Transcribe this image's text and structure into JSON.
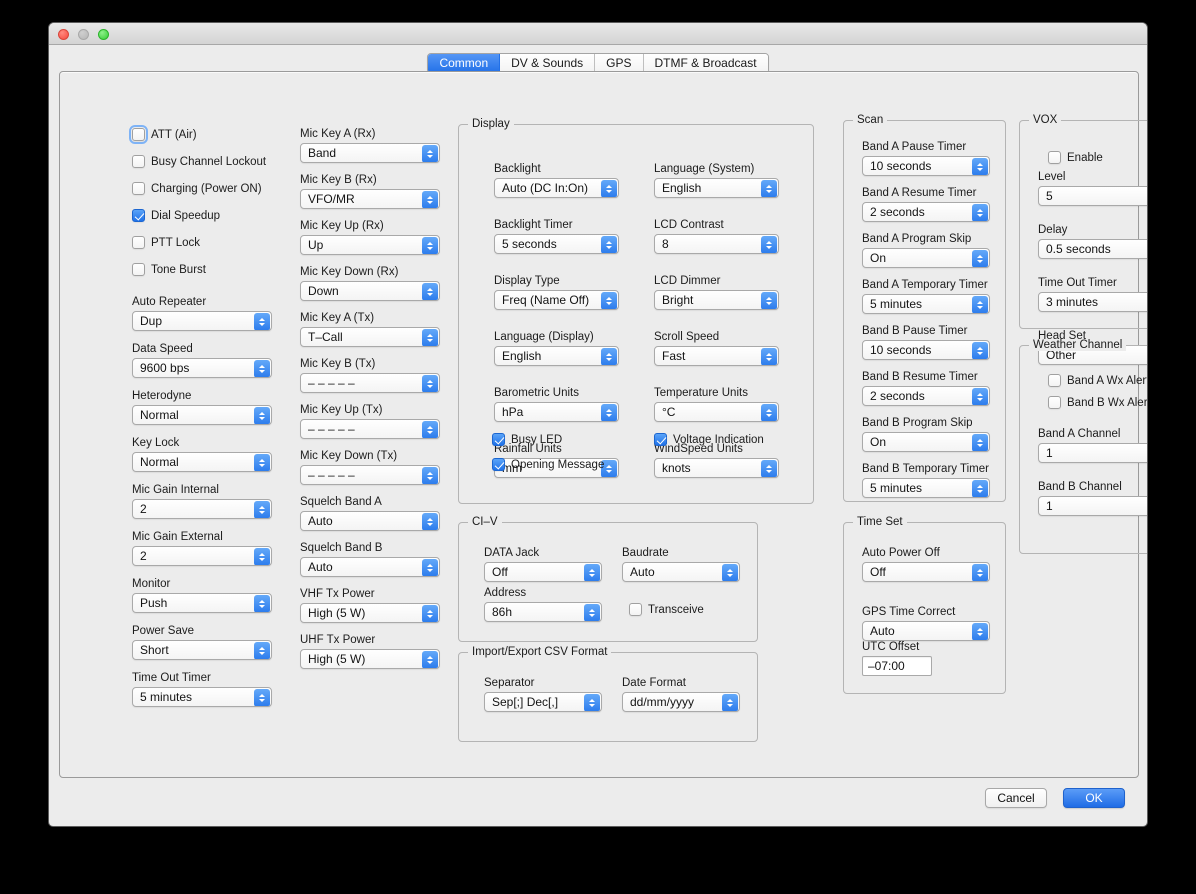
{
  "window": {
    "traffic_lights": [
      "close",
      "minimize",
      "maximize"
    ]
  },
  "tabs": [
    {
      "label": "Common",
      "active": true
    },
    {
      "label": "DV & Sounds",
      "active": false
    },
    {
      "label": "GPS",
      "active": false
    },
    {
      "label": "DTMF & Broadcast",
      "active": false
    }
  ],
  "colors": {
    "accent": "#2170e8",
    "window_bg": "#ececec",
    "border": "#b4b4b4"
  },
  "column1": {
    "checkboxes": [
      {
        "label": "ATT (Air)",
        "checked": false,
        "focused": true
      },
      {
        "label": "Busy Channel Lockout",
        "checked": false,
        "focused": false
      },
      {
        "label": "Charging (Power ON)",
        "checked": false,
        "focused": false
      },
      {
        "label": "Dial Speedup",
        "checked": true,
        "focused": false
      },
      {
        "label": "PTT Lock",
        "checked": false,
        "focused": false
      },
      {
        "label": "Tone Burst",
        "checked": false,
        "focused": false
      }
    ],
    "fields": [
      {
        "label": "Auto Repeater",
        "value": "Dup"
      },
      {
        "label": "Data Speed",
        "value": "9600 bps"
      },
      {
        "label": "Heterodyne",
        "value": "Normal"
      },
      {
        "label": "Key Lock",
        "value": "Normal"
      },
      {
        "label": "Mic Gain Internal",
        "value": "2"
      },
      {
        "label": "Mic Gain External",
        "value": "2"
      },
      {
        "label": "Monitor",
        "value": "Push"
      },
      {
        "label": "Power Save",
        "value": "Short"
      },
      {
        "label": "Time Out Timer",
        "value": "5 minutes"
      }
    ]
  },
  "column2": {
    "fields": [
      {
        "label": "Mic Key A (Rx)",
        "value": "Band"
      },
      {
        "label": "Mic Key B (Rx)",
        "value": "VFO/MR"
      },
      {
        "label": "Mic Key Up (Rx)",
        "value": "Up"
      },
      {
        "label": "Mic Key Down (Rx)",
        "value": "Down"
      },
      {
        "label": "Mic Key A (Tx)",
        "value": "T–Call"
      },
      {
        "label": "Mic Key B (Tx)",
        "value": "– – – – –"
      },
      {
        "label": "Mic Key Up (Tx)",
        "value": "– – – – –"
      },
      {
        "label": "Mic Key Down (Tx)",
        "value": "– – – – –"
      },
      {
        "label": "Squelch Band A",
        "value": "Auto"
      },
      {
        "label": "Squelch Band B",
        "value": "Auto"
      },
      {
        "label": "VHF Tx Power",
        "value": "High (5 W)"
      },
      {
        "label": "UHF Tx Power",
        "value": "High (5 W)"
      }
    ]
  },
  "display_group": {
    "title": "Display",
    "left_fields": [
      {
        "label": "Backlight",
        "value": "Auto (DC In:On)"
      },
      {
        "label": "Backlight Timer",
        "value": "5 seconds"
      },
      {
        "label": "Display Type",
        "value": "Freq (Name Off)"
      },
      {
        "label": "Language (Display)",
        "value": "English"
      },
      {
        "label": "Barometric Units",
        "value": "hPa"
      },
      {
        "label": "Rainfall Units",
        "value": "mm"
      }
    ],
    "right_fields": [
      {
        "label": "Language (System)",
        "value": "English"
      },
      {
        "label": "LCD Contrast",
        "value": "8"
      },
      {
        "label": "LCD Dimmer",
        "value": "Bright"
      },
      {
        "label": "Scroll Speed",
        "value": "Fast"
      },
      {
        "label": "Temperature Units",
        "value": "°C"
      },
      {
        "label": "WindSpeed Units",
        "value": "knots"
      }
    ],
    "checkboxes": [
      {
        "label": "Busy LED",
        "checked": true
      },
      {
        "label": "Voltage Indication",
        "checked": true
      },
      {
        "label": "Opening Message",
        "checked": true
      }
    ]
  },
  "civ_group": {
    "title": "CI–V",
    "data_jack": {
      "label": "DATA Jack",
      "value": "Off"
    },
    "baudrate": {
      "label": "Baudrate",
      "value": "Auto"
    },
    "address": {
      "label": "Address",
      "value": "86h"
    },
    "transceive": {
      "label": "Transceive",
      "checked": false
    }
  },
  "csv_group": {
    "title": "Import/Export CSV Format",
    "separator": {
      "label": "Separator",
      "value": "Sep[;] Dec[,]"
    },
    "date_format": {
      "label": "Date Format",
      "value": "dd/mm/yyyy"
    }
  },
  "scan_group": {
    "title": "Scan",
    "fields": [
      {
        "label": "Band A Pause Timer",
        "value": "10 seconds"
      },
      {
        "label": "Band A Resume Timer",
        "value": "2 seconds"
      },
      {
        "label": "Band A Program Skip",
        "value": "On"
      },
      {
        "label": "Band A Temporary Timer",
        "value": "5 minutes"
      },
      {
        "label": "Band B Pause Timer",
        "value": "10 seconds"
      },
      {
        "label": "Band B Resume Timer",
        "value": "2 seconds"
      },
      {
        "label": "Band B Program Skip",
        "value": "On"
      },
      {
        "label": "Band B Temporary Timer",
        "value": "5 minutes"
      }
    ]
  },
  "timeset_group": {
    "title": "Time Set",
    "fields": [
      {
        "label": "Auto Power Off",
        "value": "Off"
      },
      {
        "label": "GPS Time Correct",
        "value": "Auto"
      }
    ],
    "utc_offset": {
      "label": "UTC Offset",
      "value": "–07:00"
    }
  },
  "vox_group": {
    "title": "VOX",
    "enable": {
      "label": "Enable",
      "checked": false
    },
    "fields": [
      {
        "label": "Level",
        "value": "5"
      },
      {
        "label": "Delay",
        "value": "0.5 seconds"
      },
      {
        "label": "Time Out Timer",
        "value": "3 minutes"
      },
      {
        "label": "Head Set",
        "value": "Other"
      }
    ]
  },
  "weather_group": {
    "title": "Weather Channel",
    "checkboxes": [
      {
        "label": "Band A Wx Alert",
        "checked": false
      },
      {
        "label": "Band B Wx Alert",
        "checked": false
      }
    ],
    "fields": [
      {
        "label": "Band A Channel",
        "value": "1"
      },
      {
        "label": "Band B Channel",
        "value": "1"
      }
    ]
  },
  "footer": {
    "cancel_label": "Cancel",
    "ok_label": "OK"
  }
}
